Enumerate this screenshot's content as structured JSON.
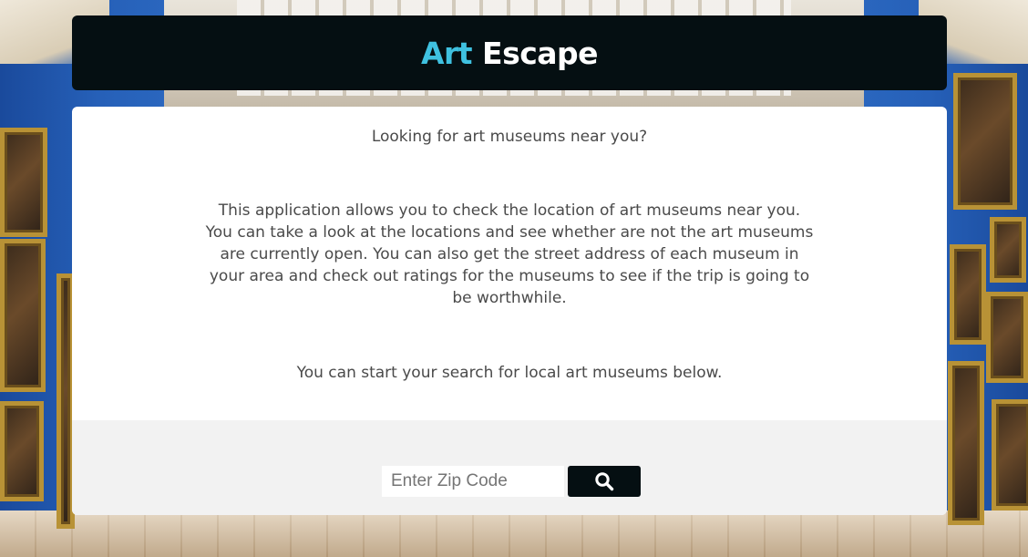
{
  "header": {
    "title_accent": "Art",
    "title_main": "Escape"
  },
  "intro": {
    "question": "Looking for art museums near you?",
    "description": "This application allows you to check the location of art museums near you. You can take a look at the locations and see whether are not the art museums are currently open. You can also get the street address of each museum in your area and check out ratings for the museums to see if the trip is going to be worthwhile.",
    "cta": "You can start your search for local art museums below."
  },
  "search": {
    "placeholder": "Enter Zip Code",
    "value": "",
    "button_icon": "search-icon"
  },
  "colors": {
    "accent": "#3fc1e0",
    "header_bg": "#050f12",
    "search_bar_bg": "#f2f2f2"
  }
}
